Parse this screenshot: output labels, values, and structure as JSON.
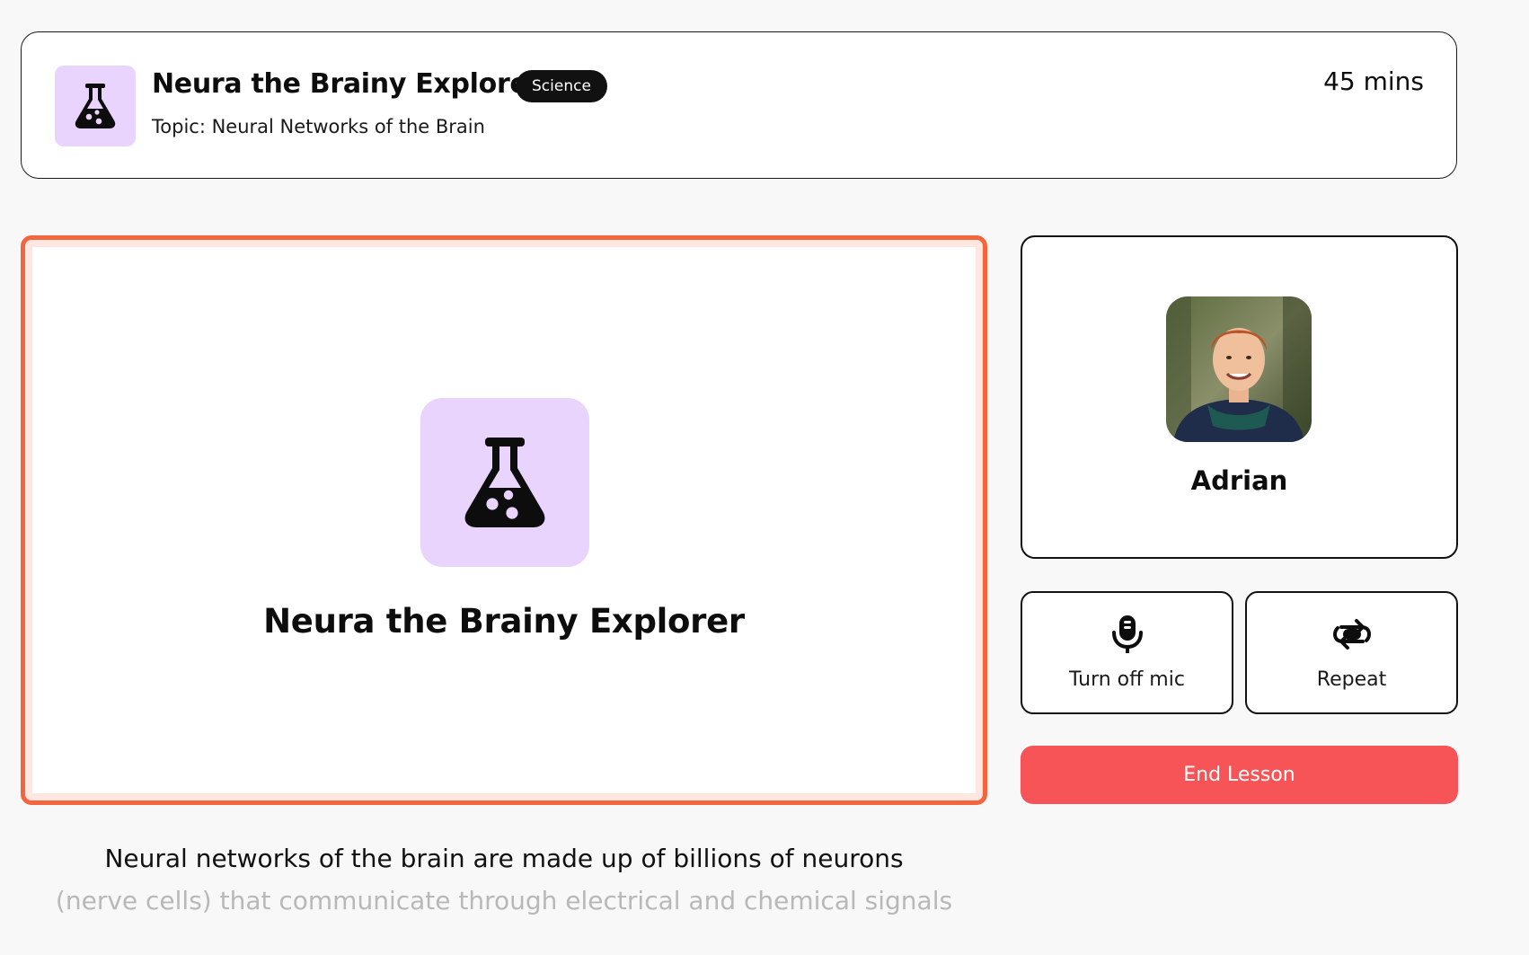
{
  "header": {
    "title": "Neura the Brainy Explorer",
    "subject_badge": "Science",
    "topic": "Topic: Neural Networks of the Brain",
    "duration": "45 mins",
    "icon": "flask-icon"
  },
  "stage": {
    "title": "Neura the Brainy Explorer",
    "icon": "flask-icon"
  },
  "participant": {
    "name": "Adrian"
  },
  "controls": {
    "mic_label": "Turn off mic",
    "mic_icon": "microphone-icon",
    "repeat_label": "Repeat",
    "repeat_icon": "repeat-icon",
    "end_label": "End Lesson"
  },
  "caption": {
    "line1": "Neural networks of the brain are made up of billions of neurons",
    "line2": "(nerve cells) that communicate through electrical and chemical signals"
  },
  "colors": {
    "accent_purple": "#e8d4fc",
    "stage_border": "#f4653d",
    "end_button": "#f65456"
  }
}
